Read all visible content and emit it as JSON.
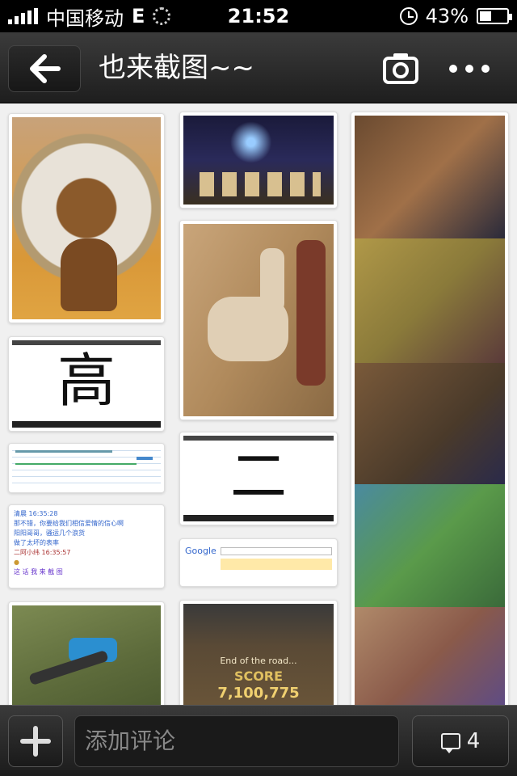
{
  "status_bar": {
    "carrier": "中国移动",
    "network": "E",
    "time": "21:52",
    "battery_text": "43%",
    "battery_level": 0.43
  },
  "nav": {
    "title": "也来截图~~",
    "back_icon": "arrow-left-icon",
    "camera_icon": "camera-icon",
    "more_icon": "more-dots-icon"
  },
  "grid": {
    "col1": {
      "writing_char": "高",
      "chat_name1": "清晨",
      "chat_time1": "16:35:28",
      "chat_line1": "那不错，你要给我们相信爱情的信心啊",
      "chat_line2": "阳阳哥哥，骚运几个浪货",
      "chat_line3": "做了太坏的表率",
      "chat_name2": "二阿小纬",
      "chat_time2": "16:35:57",
      "chat_line4": "这 话 我 来 截 图"
    },
    "col2": {
      "writing_char": "二",
      "google_logo": "Google",
      "game_caption": "End of the road...",
      "score_label": "SCORE",
      "score_value": "7,100,775"
    }
  },
  "bottom_bar": {
    "comment_placeholder": "添加评论",
    "comment_count": "4"
  }
}
